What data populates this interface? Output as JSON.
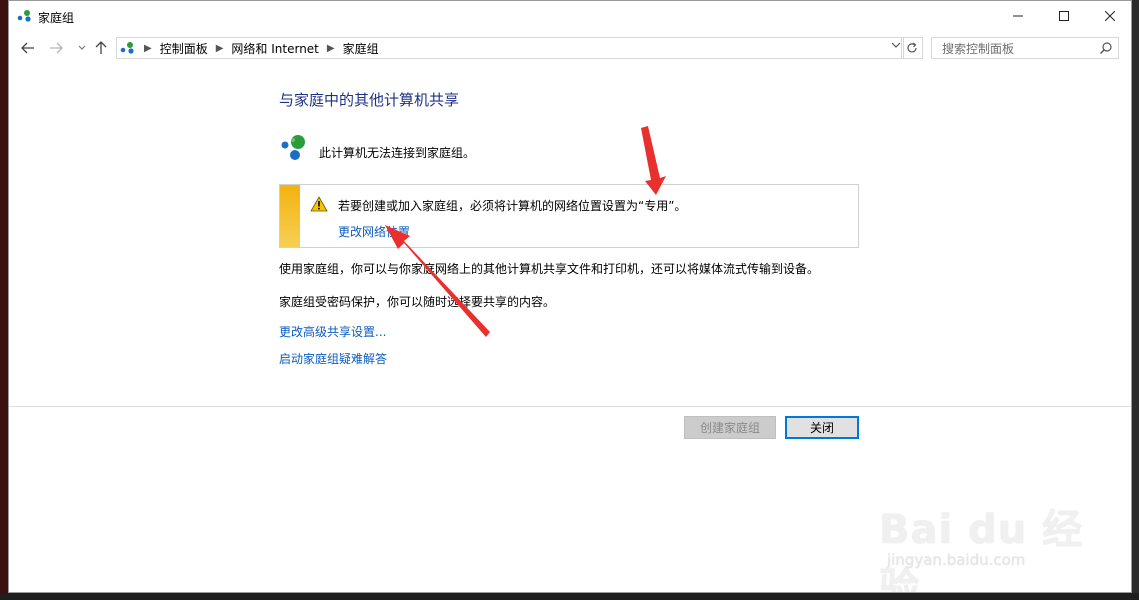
{
  "window": {
    "title": "家庭组",
    "minimize_icon": "minimize-icon",
    "maximize_icon": "maximize-icon",
    "close_icon": "close-icon"
  },
  "nav": {
    "back_icon": "back-arrow-icon",
    "forward_icon": "forward-arrow-icon",
    "recent_icon": "chevron-down-icon",
    "up_icon": "up-arrow-icon"
  },
  "address": {
    "crumbs": [
      "控制面板",
      "网络和 Internet",
      "家庭组"
    ],
    "refresh_icon": "refresh-icon"
  },
  "search": {
    "placeholder": "搜索控制面板",
    "icon": "search-icon"
  },
  "main": {
    "heading": "与家庭中的其他计算机共享",
    "status_text": "此计算机无法连接到家庭组。",
    "warning_text": "若要创建或加入家庭组，必须将计算机的网络位置设置为“专用”。",
    "warning_link": "更改网络位置",
    "paragraph1": "使用家庭组，你可以与你家庭网络上的其他计算机共享文件和打印机，还可以将媒体流式传输到设备。",
    "paragraph2": "家庭组受密码保护，你可以随时选择要共享的内容。",
    "link_advanced": "更改高级共享设置...",
    "link_troubleshoot": "启动家庭组疑难解答"
  },
  "footer": {
    "create_button": "创建家庭组",
    "close_button": "关闭"
  },
  "watermark": {
    "main": "Bai du 经验",
    "sub": "jingyan.baidu.com"
  },
  "colors": {
    "heading": "#1e3287",
    "link": "#0b5cbd",
    "warning_bar": "#f3b20e",
    "close_button_border": "#0078d7",
    "annotation_arrow": "#e8302f"
  }
}
